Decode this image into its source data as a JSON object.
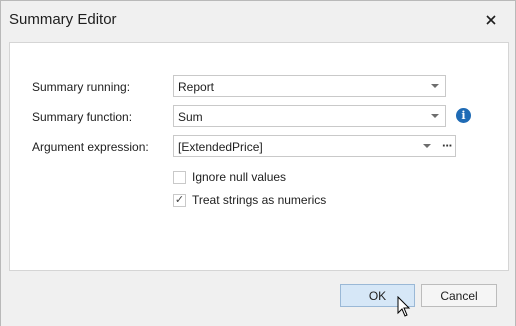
{
  "window": {
    "title": "Summary Editor"
  },
  "fields": {
    "summary_running": {
      "label": "Summary running:",
      "value": "Report"
    },
    "summary_function": {
      "label": "Summary function:",
      "value": "Sum"
    },
    "argument_expression": {
      "label": "Argument expression:",
      "value": "[ExtendedPrice]"
    }
  },
  "options": {
    "ignore_null": {
      "label": "Ignore null values",
      "checked": false
    },
    "treat_strings": {
      "label": "Treat strings as numerics",
      "checked": true,
      "mark": "✓"
    }
  },
  "buttons": {
    "ok": "OK",
    "cancel": "Cancel"
  },
  "icons": {
    "close": "close-icon",
    "info": "info-icon",
    "ellipsis": "···",
    "info_glyph": "i"
  },
  "colors": {
    "accent": "#1f6bb5",
    "ok_button_bg": "#d6e7f7"
  }
}
